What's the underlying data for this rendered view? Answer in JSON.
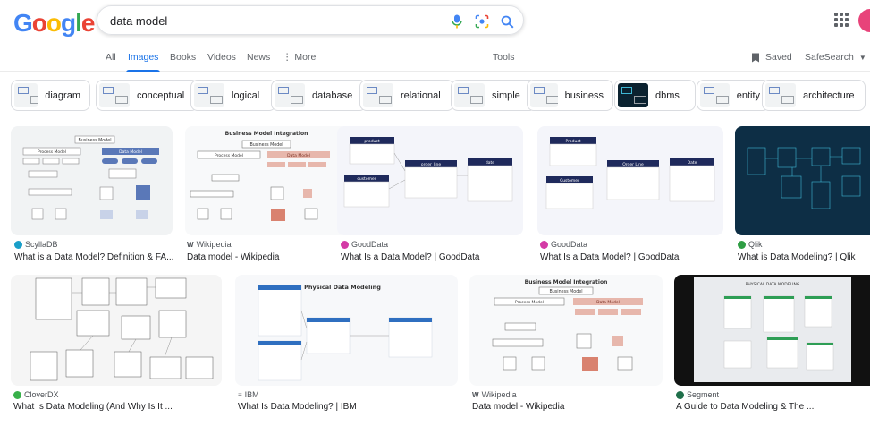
{
  "logo": {
    "text": "Google",
    "letters": [
      "G",
      "o",
      "o",
      "g",
      "l",
      "e"
    ],
    "colors": [
      "#4285f4",
      "#ea4335",
      "#fbbc05",
      "#4285f4",
      "#34a853",
      "#ea4335"
    ]
  },
  "search": {
    "query": "data model",
    "mic_icon": "mic-icon",
    "lens_icon": "camera-lens-icon",
    "search_icon": "search-icon"
  },
  "tabs": {
    "all": "All",
    "images": "Images",
    "books": "Books",
    "videos": "Videos",
    "news": "News",
    "more": "More",
    "tools": "Tools",
    "saved": "Saved",
    "safesearch": "SafeSearch"
  },
  "chips": [
    "diagram",
    "conceptual",
    "logical",
    "database",
    "relational",
    "simple",
    "business",
    "dbms",
    "entity",
    "architecture"
  ],
  "results": [
    {
      "source": "ScyllaDB",
      "title": "What is a Data Model? Definition & FA...",
      "fav": "#1a9fc9"
    },
    {
      "source": "Wikipedia",
      "title": "Data model - Wikipedia",
      "fav": "#202124"
    },
    {
      "source": "GoodData",
      "title": "What Is a Data Model? | GoodData",
      "fav": "#d43ba6"
    },
    {
      "source": "GoodData",
      "title": "What Is a Data Model? | GoodData",
      "fav": "#d43ba6"
    },
    {
      "source": "Qlik",
      "title": "What is Data Modeling? | Qlik",
      "fav": "#2f9e44"
    },
    {
      "source": "CloverDX",
      "title": "What Is Data Modeling (And Why Is It ...",
      "fav": "#38b04a"
    },
    {
      "source": "IBM",
      "title": "What Is Data Modeling? | IBM",
      "fav": "#5f6368"
    },
    {
      "source": "Wikipedia",
      "title": "Data model - Wikipedia",
      "fav": "#202124"
    },
    {
      "source": "Segment",
      "title": "A Guide to Data Modeling & The ...",
      "fav": "#1f6f4a"
    }
  ],
  "thumbs": {
    "business_model": "Business Model",
    "business_model_integration": "Business Model Integration",
    "process_model": "Process Model",
    "data_model": "Data Model",
    "physical_data_modeling": "Physical Data Modeling",
    "physical_data_modeling_caps": "PHYSICAL DATA MODELING",
    "product": "product",
    "customer": "customer",
    "order_line": "order_line",
    "date": "date",
    "product_cap": "Product",
    "customer_cap": "Customer",
    "order_line_cap": "Order Line",
    "date_cap": "Date"
  }
}
